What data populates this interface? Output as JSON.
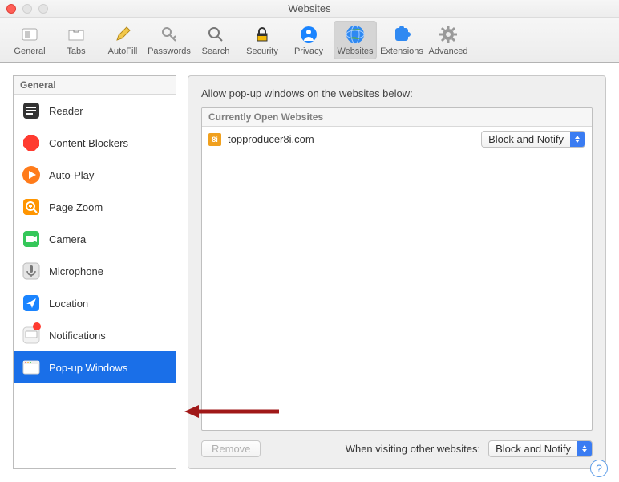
{
  "window": {
    "title": "Websites"
  },
  "toolbar": [
    {
      "id": "general",
      "label": "General"
    },
    {
      "id": "tabs",
      "label": "Tabs"
    },
    {
      "id": "autofill",
      "label": "AutoFill"
    },
    {
      "id": "passwords",
      "label": "Passwords"
    },
    {
      "id": "search",
      "label": "Search"
    },
    {
      "id": "security",
      "label": "Security"
    },
    {
      "id": "privacy",
      "label": "Privacy"
    },
    {
      "id": "websites",
      "label": "Websites",
      "active": true
    },
    {
      "id": "extensions",
      "label": "Extensions"
    },
    {
      "id": "advanced",
      "label": "Advanced"
    }
  ],
  "sidebar": {
    "header": "General",
    "items": [
      {
        "id": "reader",
        "label": "Reader"
      },
      {
        "id": "blockers",
        "label": "Content Blockers"
      },
      {
        "id": "autoplay",
        "label": "Auto-Play"
      },
      {
        "id": "pagezoom",
        "label": "Page Zoom"
      },
      {
        "id": "camera",
        "label": "Camera"
      },
      {
        "id": "microphone",
        "label": "Microphone"
      },
      {
        "id": "location",
        "label": "Location"
      },
      {
        "id": "notifications",
        "label": "Notifications",
        "badge": true
      },
      {
        "id": "popups",
        "label": "Pop-up Windows",
        "selected": true
      }
    ]
  },
  "content": {
    "title": "Allow pop-up windows on the websites below:",
    "open_sites_header": "Currently Open Websites",
    "rows": [
      {
        "favicon_text": "8i",
        "favicon_bg": "#f0a01e",
        "domain": "topproducer8i.com",
        "policy": "Block and Notify"
      }
    ],
    "remove_label": "Remove",
    "other_label": "When visiting other websites:",
    "other_policy": "Block and Notify"
  }
}
